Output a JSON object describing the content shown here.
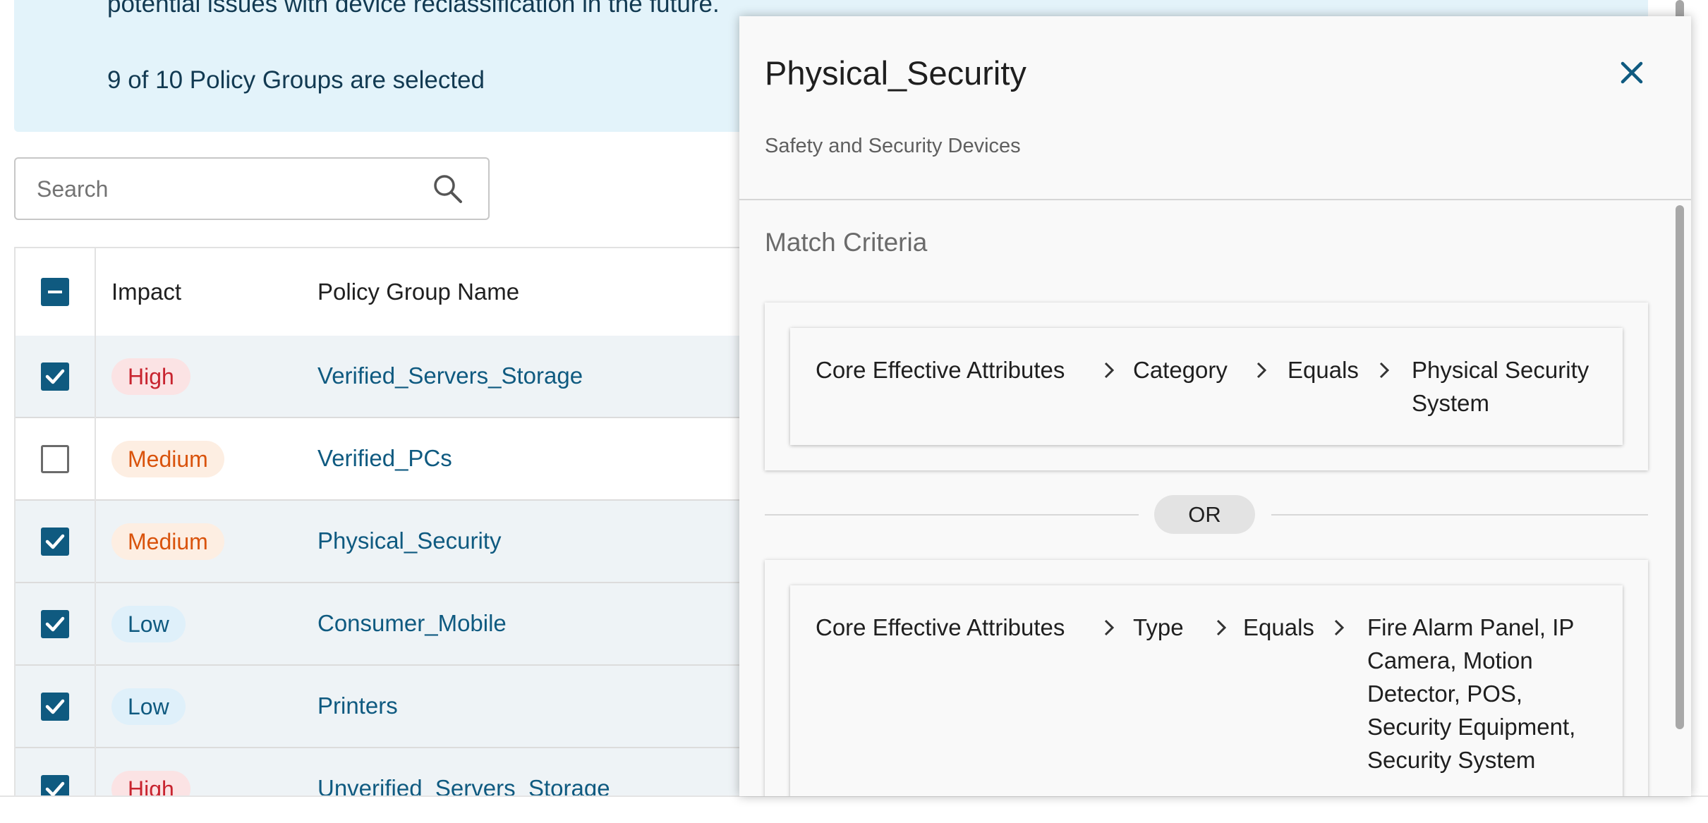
{
  "banner": {
    "text_partial": "potential issues with device reclassification in the future.",
    "selection_summary": "9 of 10 Policy Groups are selected"
  },
  "search": {
    "placeholder": "Search",
    "value": ""
  },
  "table": {
    "header": {
      "select_all_state": "indeterminate",
      "impact": "Impact",
      "policy_group_name": "Policy Group Name"
    },
    "rows": [
      {
        "checked": true,
        "impact": "High",
        "impact_level": "high",
        "name": "Verified_Servers_Storage"
      },
      {
        "checked": false,
        "impact": "Medium",
        "impact_level": "medium",
        "name": "Verified_PCs"
      },
      {
        "checked": true,
        "impact": "Medium",
        "impact_level": "medium",
        "name": "Physical_Security"
      },
      {
        "checked": true,
        "impact": "Low",
        "impact_level": "low",
        "name": "Consumer_Mobile"
      },
      {
        "checked": true,
        "impact": "Low",
        "impact_level": "low",
        "name": "Printers"
      },
      {
        "checked": true,
        "impact": "High",
        "impact_level": "high",
        "name": "Unverified_Servers_Storage"
      }
    ]
  },
  "panel": {
    "title": "Physical_Security",
    "subtitle": "Safety and Security Devices",
    "match_criteria_title": "Match Criteria",
    "or_label": "OR",
    "criteria": [
      {
        "source": "Core Effective Attributes",
        "attribute": "Category",
        "operator": "Equals",
        "value": "Physical Security System"
      },
      {
        "source": "Core Effective Attributes",
        "attribute": "Type",
        "operator": "Equals",
        "value": "Fire Alarm Panel, IP Camera, Motion Detector, POS, Security Equipment, Security System"
      }
    ]
  },
  "colors": {
    "accent": "#0f5a80",
    "banner_bg": "#e3f3fa",
    "high_bg": "#fbe3e4",
    "high_fg": "#c8242f",
    "medium_bg": "#fdeee2",
    "medium_fg": "#d9530c",
    "low_bg": "#dff0fa",
    "low_fg": "#0f5a80"
  },
  "icons": [
    "search-icon",
    "close-icon",
    "chevron-right-icon",
    "checkbox-checked-icon",
    "checkbox-indeterminate-icon"
  ]
}
